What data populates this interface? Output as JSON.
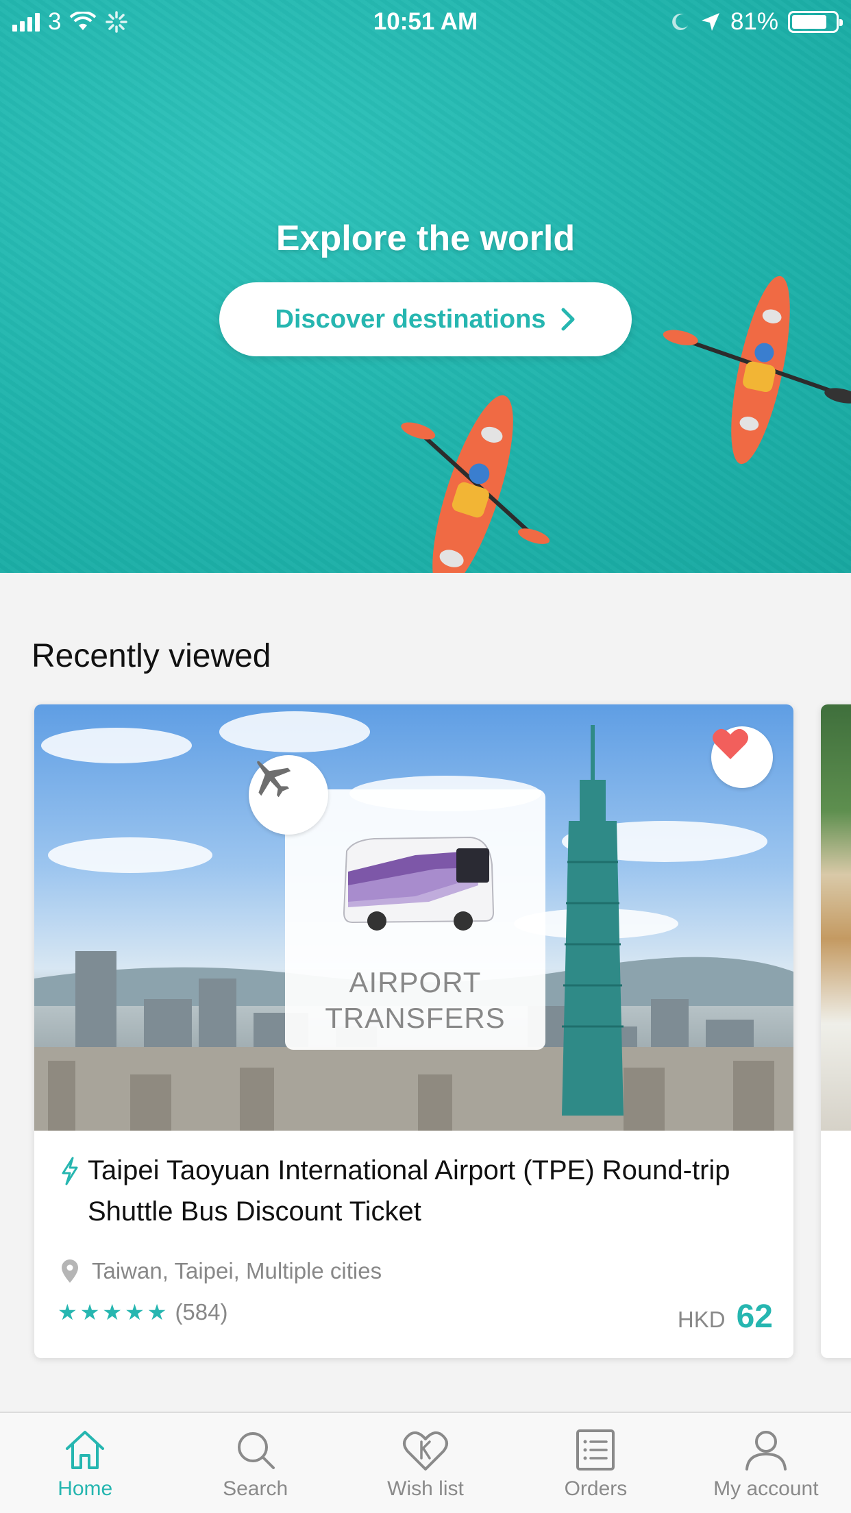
{
  "status_bar": {
    "carrier": "3",
    "time": "10:51 AM",
    "battery": "81%",
    "battery_level": 0.81
  },
  "hero": {
    "title": "Explore the world",
    "cta_label": "Discover destinations"
  },
  "recently_viewed": {
    "title": "Recently viewed",
    "card": {
      "image_badge_line1": "AIRPORT",
      "image_badge_line2": "TRANSFERS",
      "title": "Taipei Taoyuan International Airport (TPE) Round-trip Shuttle Bus Discount Ticket",
      "location": "Taiwan, Taipei, Multiple cities",
      "rating_stars": 5,
      "review_count": "(584)",
      "currency": "HKD",
      "price": "62",
      "wishlisted": true
    }
  },
  "tabbar": {
    "items": [
      {
        "label": "Home",
        "icon": "home-icon",
        "active": true
      },
      {
        "label": "Search",
        "icon": "search-icon",
        "active": false
      },
      {
        "label": "Wish list",
        "icon": "wishlist-heart-icon",
        "active": false
      },
      {
        "label": "Orders",
        "icon": "orders-icon",
        "active": false
      },
      {
        "label": "My account",
        "icon": "account-icon",
        "active": false
      }
    ]
  },
  "colors": {
    "accent": "#26b6b0",
    "hero_bg": "#1fb3ab",
    "heart": "#f25f5c"
  }
}
